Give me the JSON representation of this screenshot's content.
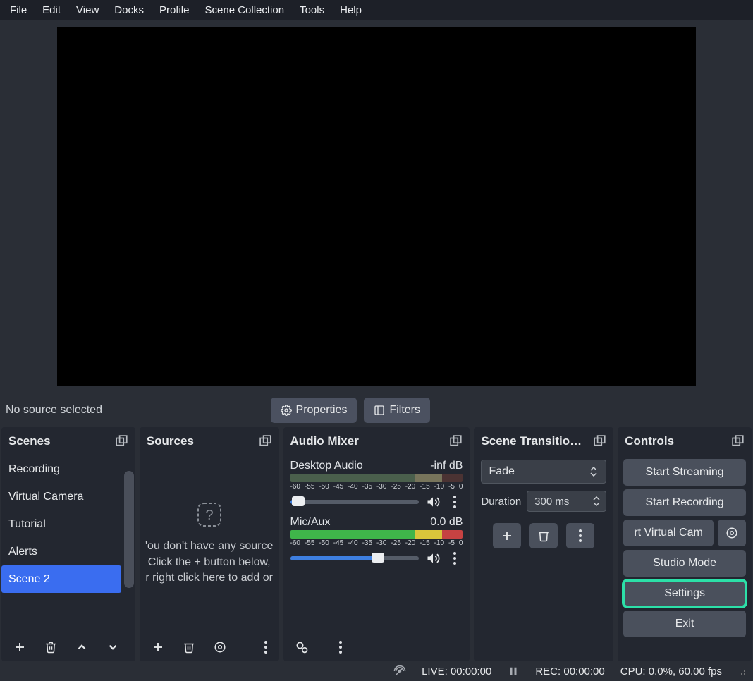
{
  "menu": [
    "File",
    "Edit",
    "View",
    "Docks",
    "Profile",
    "Scene Collection",
    "Tools",
    "Help"
  ],
  "toolbar": {
    "no_source": "No source selected",
    "properties": "Properties",
    "filters": "Filters"
  },
  "scenes": {
    "title": "Scenes",
    "items": [
      "Recording",
      "Virtual Camera",
      "Tutorial",
      "Alerts",
      "Scene 2"
    ],
    "selected_index": 4
  },
  "sources": {
    "title": "Sources",
    "empty_lines": [
      "'ou don't have any source",
      "Click the + button below,",
      "r right click here to add or"
    ]
  },
  "mixer": {
    "title": "Audio Mixer",
    "tick_labels": [
      "-60",
      "-55",
      "-50",
      "-45",
      "-40",
      "-35",
      "-30",
      "-25",
      "-20",
      "-15",
      "-10",
      "-5",
      "0"
    ],
    "channels": [
      {
        "name": "Desktop Audio",
        "db": "-inf dB",
        "slider_pct": 6,
        "muted": false
      },
      {
        "name": "Mic/Aux",
        "db": "0.0 dB",
        "slider_pct": 68,
        "muted": false
      }
    ]
  },
  "transitions": {
    "title": "Scene Transitio…",
    "current": "Fade",
    "duration_label": "Duration",
    "duration_value": "300 ms"
  },
  "controls": {
    "title": "Controls",
    "buttons": {
      "streaming": "Start Streaming",
      "recording": "Start Recording",
      "virtualcam": "rt Virtual Cam",
      "studio": "Studio Mode",
      "settings": "Settings",
      "exit": "Exit"
    }
  },
  "status": {
    "live": "LIVE: 00:00:00",
    "rec": "REC: 00:00:00",
    "cpu": "CPU: 0.0%, 60.00 fps"
  }
}
